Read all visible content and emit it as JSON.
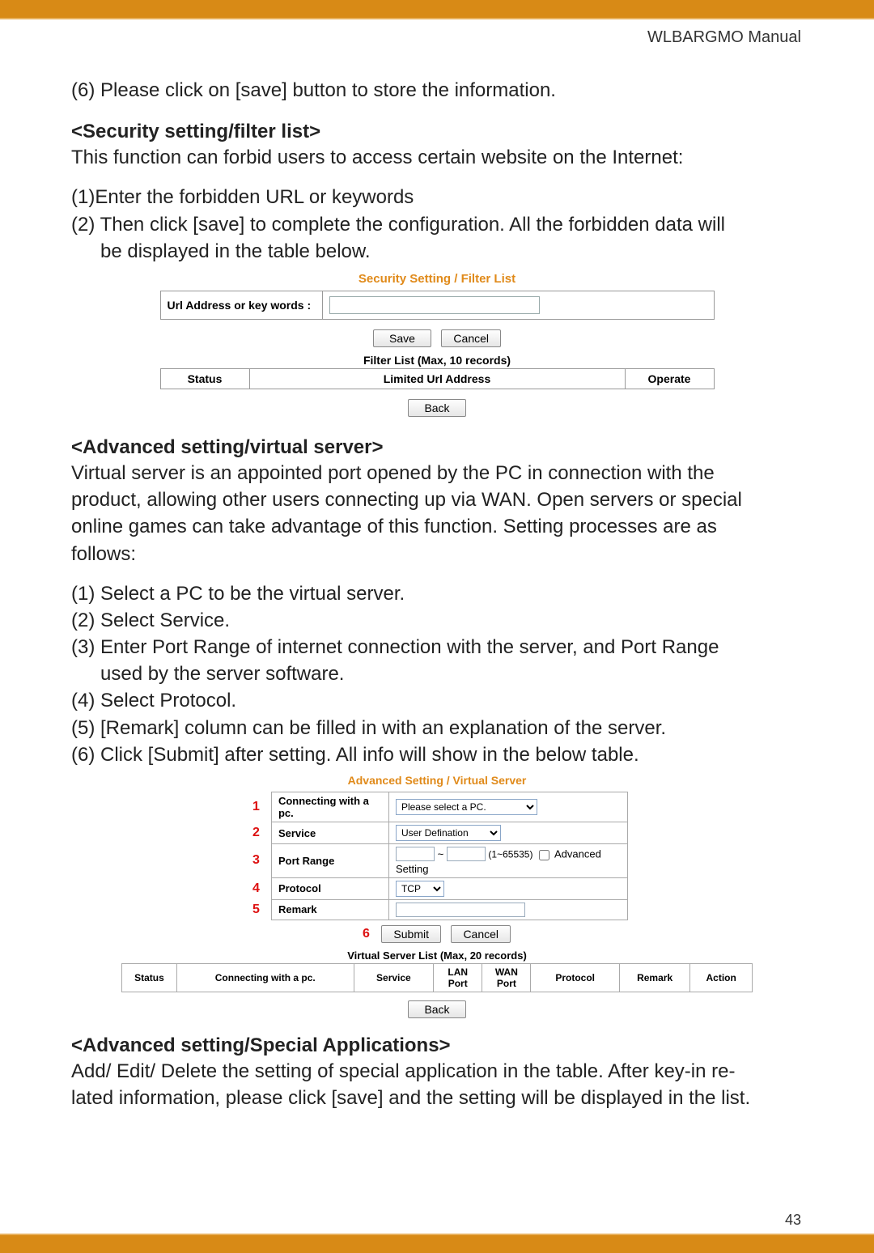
{
  "header": {
    "manual_title": "WLBARGMO Manual"
  },
  "intro": {
    "step6": "(6) Please click on [save] button to store the information."
  },
  "filter": {
    "heading": "<Security setting/filter list>",
    "desc": "This function can forbid users to access certain website on the Internet:",
    "step1": "(1)Enter the forbidden URL or keywords",
    "step2a": "(2) Then click [save] to complete the configuration. All the forbidden data will",
    "step2b": "be displayed in the table below.",
    "shot": {
      "title": "Security Setting / Filter List",
      "row_label": "Url Address or key words :",
      "btn_save": "Save",
      "btn_cancel": "Cancel",
      "list_title": "Filter List (Max, 10 records)",
      "cols": {
        "status": "Status",
        "limited": "Limited Url Address",
        "operate": "Operate"
      },
      "btn_back": "Back"
    }
  },
  "vserver": {
    "heading": "<Advanced setting/virtual server>",
    "desc1": "Virtual server is an appointed port opened by the PC in connection with the",
    "desc2": "product, allowing other users connecting up via WAN.  Open servers or special",
    "desc3": "online games can take advantage of this function.  Setting processes are as",
    "desc4": "follows:",
    "s1": "(1) Select a PC to be the virtual server.",
    "s2": "(2) Select Service.",
    "s3a": "(3) Enter Port Range of internet connection with the server, and Port Range",
    "s3b": "used by the server software.",
    "s4": "(4) Select Protocol.",
    "s5": "(5) [Remark] column can be filled in with an explanation of the server.",
    "s6": "(6) Click [Submit] after setting.  All info will show in the below table.",
    "shot": {
      "title": "Advanced Setting / Virtual Server",
      "nums": {
        "n1": "1",
        "n2": "2",
        "n3": "3",
        "n4": "4",
        "n5": "5",
        "n6": "6"
      },
      "labels": {
        "connecting": "Connecting with a pc.",
        "service": "Service",
        "portrange": "Port Range",
        "protocol": "Protocol",
        "remark": "Remark"
      },
      "values": {
        "pc_selected": "Please select a PC.",
        "service_selected": "User Defination",
        "port_sep": "~",
        "port_hint": "(1~65535)",
        "adv_chk_label": "Advanced Setting",
        "protocol_selected": "TCP"
      },
      "btn_submit": "Submit",
      "btn_cancel": "Cancel",
      "list_title": "Virtual Server List (Max, 20 records)",
      "cols": {
        "status": "Status",
        "connecting": "Connecting with a pc.",
        "service": "Service",
        "lanport": "LAN Port",
        "wanport": "WAN Port",
        "protocol": "Protocol",
        "remark": "Remark",
        "action": "Action"
      },
      "btn_back": "Back"
    }
  },
  "special": {
    "heading": "<Advanced setting/Special Applications>",
    "l1": "Add/ Edit/ Delete the setting of special application in the table. After key-in re-",
    "l2": "lated information, please click [save] and the setting will be displayed in the list."
  },
  "footer": {
    "page_num": "43"
  }
}
